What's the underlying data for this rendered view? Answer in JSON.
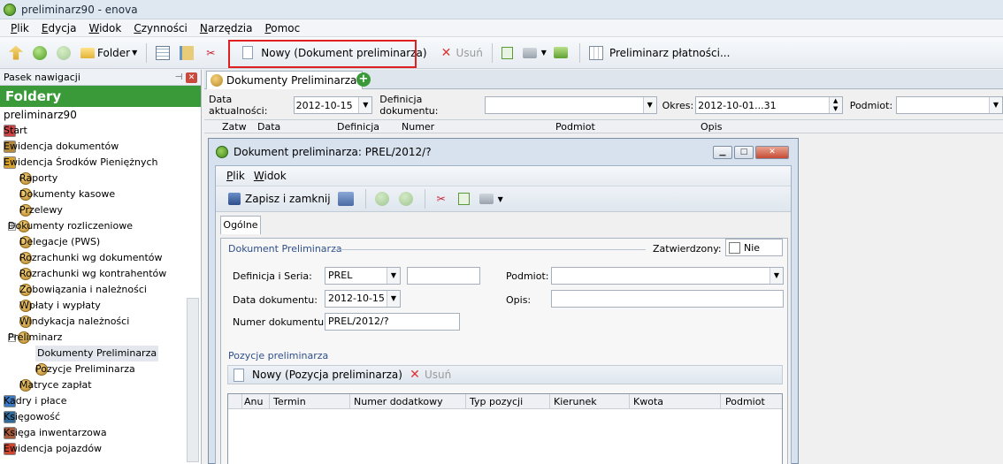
{
  "window": {
    "title": "preliminarz90 - enova"
  },
  "menu": [
    "Plik",
    "Edycja",
    "Widok",
    "Czynności",
    "Narzędzia",
    "Pomoc"
  ],
  "toolbar": {
    "folder_label": "Folder",
    "new_label": "Nowy (Dokument preliminarza)",
    "delete_label": "Usuń",
    "schedule_label": "Preliminarz płatności..."
  },
  "nav": {
    "header": "Pasek nawigacji",
    "title": "Foldery",
    "root": "preliminarz90",
    "items": [
      {
        "label": "Start",
        "level": 0
      },
      {
        "label": "Ewidencja dokumentów",
        "level": 0
      },
      {
        "label": "Ewidencja Środków Pieniężnych",
        "level": 0
      },
      {
        "label": "Raporty",
        "level": 1
      },
      {
        "label": "Dokumenty kasowe",
        "level": 1
      },
      {
        "label": "Przelewy",
        "level": 1
      },
      {
        "label": "Dokumenty rozliczeniowe",
        "level": 1
      },
      {
        "label": "Delegacje (PWS)",
        "level": 1
      },
      {
        "label": "Rozrachunki wg dokumentów",
        "level": 1
      },
      {
        "label": "Rozrachunki wg kontrahentów",
        "level": 1
      },
      {
        "label": "Zobowiązania i należności",
        "level": 1
      },
      {
        "label": "Wpłaty i wypłaty",
        "level": 1
      },
      {
        "label": "Windykacja należności",
        "level": 1
      },
      {
        "label": "Preliminarz",
        "level": 1
      },
      {
        "label": "Dokumenty Preliminarza",
        "level": 2
      },
      {
        "label": "Pozycje Preliminarza",
        "level": 2
      },
      {
        "label": "Matryce zapłat",
        "level": 1
      },
      {
        "label": "Kadry i płace",
        "level": 0
      },
      {
        "label": "Księgowość",
        "level": 0
      },
      {
        "label": "Księga inwentarzowa",
        "level": 0
      },
      {
        "label": "Ewidencja pojazdów",
        "level": 0
      }
    ]
  },
  "tab": {
    "label": "Dokumenty Preliminarza"
  },
  "filters": {
    "date_label": "Data aktualności:",
    "date_value": "2012-10-15",
    "def_label": "Definicja dokumentu:",
    "def_value": "",
    "period_label": "Okres:",
    "period_value": "2012-10-01...31",
    "subject_label": "Podmiot:",
    "subject_value": ""
  },
  "grid_columns": [
    "Zatw",
    "Data",
    "Definicja",
    "Numer",
    "Podmiot",
    "Opis"
  ],
  "doc": {
    "title": "Dokument preliminarza: PREL/2012/?",
    "menu": [
      "Plik",
      "Widok"
    ],
    "save_close": "Zapisz i zamknij",
    "tab": "Ogólne",
    "section_title": "Dokument Preliminarza",
    "approved_label": "Zatwierdzony:",
    "approved_value": "Nie",
    "def_label": "Definicja i Seria:",
    "def_value": "PREL",
    "series_value": "",
    "subject_label": "Podmiot:",
    "subject_value": "",
    "date_label": "Data dokumentu:",
    "date_value": "2012-10-15",
    "desc_label": "Opis:",
    "desc_value": "",
    "number_label": "Numer dokumentu:",
    "number_value": "PREL/2012/?",
    "positions_title": "Pozycje preliminarza",
    "new_position": "Nowy (Pozycja preliminarza)",
    "delete_position": "Usuń",
    "pos_columns": [
      "Anu",
      "Termin",
      "Numer dodatkowy",
      "Typ pozycji",
      "Kierunek",
      "Kwota",
      "Podmiot"
    ]
  }
}
